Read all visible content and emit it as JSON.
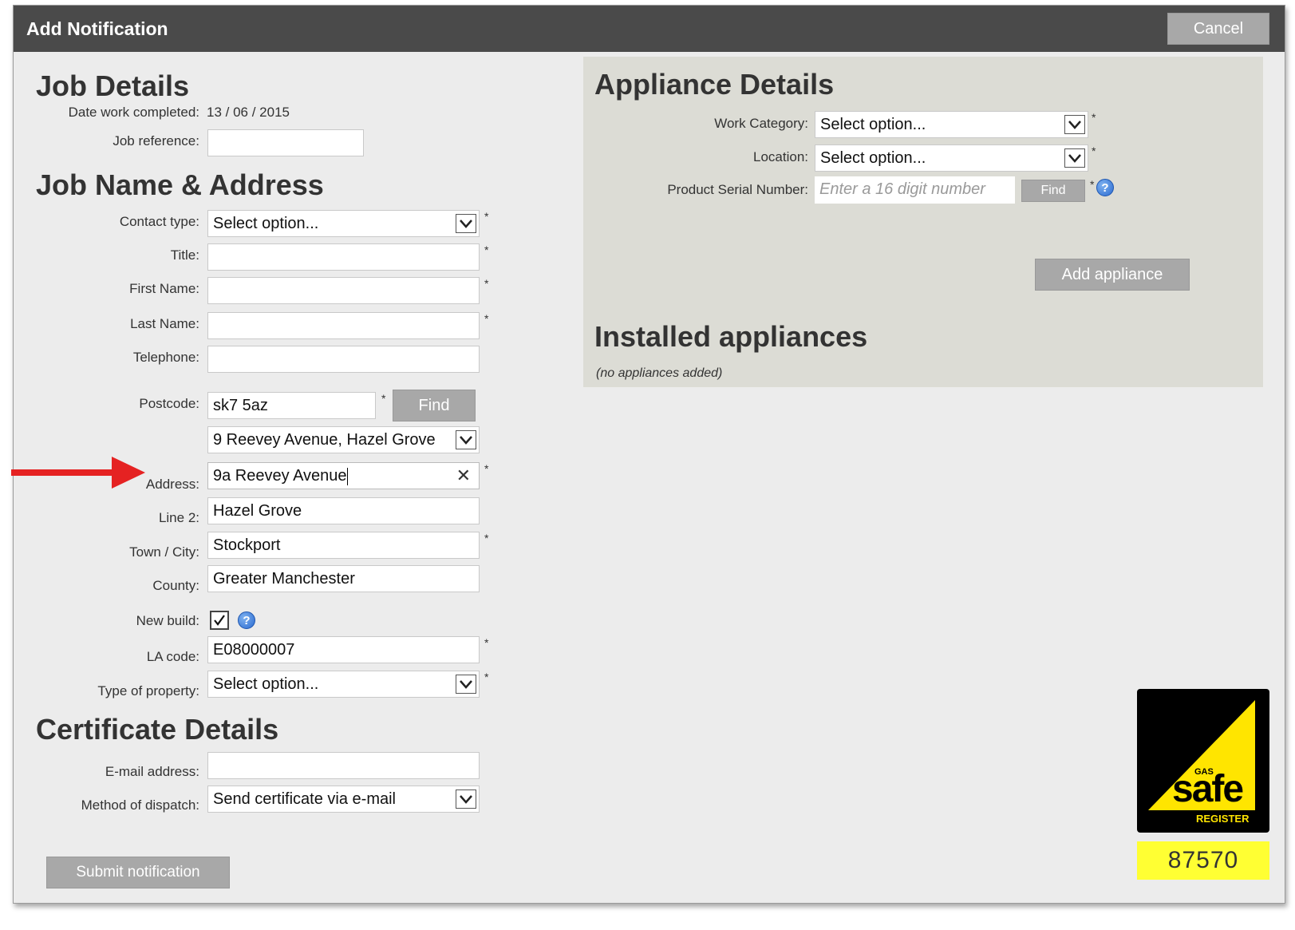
{
  "window": {
    "title": "Add Notification",
    "cancel_label": "Cancel"
  },
  "job_details": {
    "heading": "Job Details",
    "date_label": "Date work completed:",
    "date_value": "13 / 06 / 2015",
    "ref_label": "Job reference:",
    "ref_value": ""
  },
  "job_name_address": {
    "heading": "Job Name & Address",
    "contact_type_label": "Contact type:",
    "contact_type_value": "Select option...",
    "title_label": "Title:",
    "first_name_label": "First Name:",
    "last_name_label": "Last Name:",
    "telephone_label": "Telephone:",
    "postcode_label": "Postcode:",
    "postcode_value": "sk7 5az",
    "find_label": "Find",
    "address_select_value": "9 Reevey Avenue, Hazel Grove",
    "address_label": "Address:",
    "address_value": "9a Reevey Avenue",
    "line2_label": "Line 2:",
    "line2_value": "Hazel Grove",
    "town_label": "Town / City:",
    "town_value": "Stockport",
    "county_label": "County:",
    "county_value": "Greater Manchester",
    "new_build_label": "New build:",
    "new_build_checked": true,
    "la_code_label": "LA code:",
    "la_code_value": "E08000007",
    "property_type_label": "Type of property:",
    "property_type_value": "Select option..."
  },
  "certificate": {
    "heading": "Certificate Details",
    "email_label": "E-mail address:",
    "dispatch_label": "Method of dispatch:",
    "dispatch_value": "Send certificate via e-mail"
  },
  "submit_label": "Submit notification",
  "appliance": {
    "heading": "Appliance Details",
    "work_category_label": "Work Category:",
    "work_category_value": "Select option...",
    "location_label": "Location:",
    "location_value": "Select option...",
    "serial_label": "Product Serial Number:",
    "serial_placeholder": "Enter a 16 digit number",
    "find_label": "Find",
    "add_label": "Add appliance"
  },
  "installed": {
    "heading": "Installed appliances",
    "empty_text": "(no appliances added)"
  },
  "gas_safe": {
    "logo_small": "GAS",
    "logo_word": "safe",
    "logo_sub": "REGISTER",
    "number": "87570"
  },
  "colors": {
    "titlebar": "#4a4a4a",
    "button": "#a8a8a8",
    "panel": "#dcdcd5",
    "logo_yellow": "#ffe500",
    "number_bg": "#ffff33"
  }
}
